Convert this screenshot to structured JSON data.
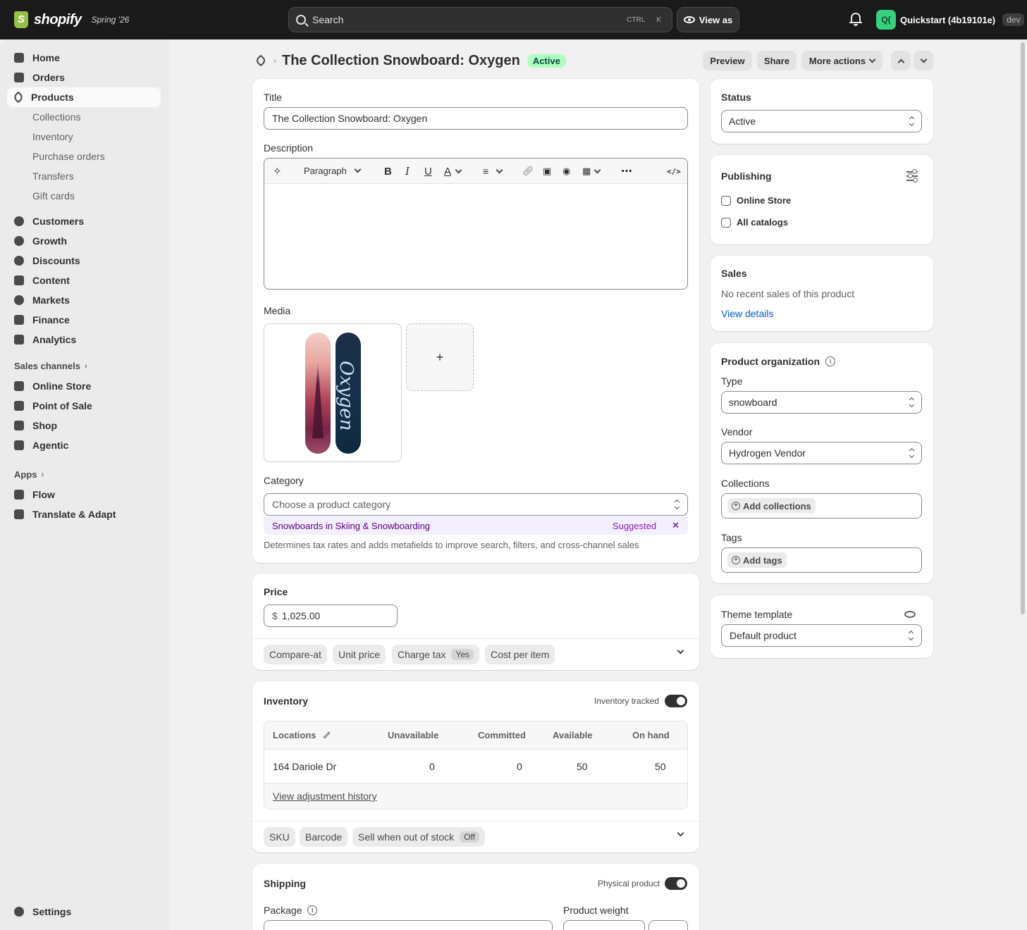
{
  "topbar": {
    "brand": "shopify",
    "edition": "Spring '26",
    "search_placeholder": "Search",
    "shortcut_ctrl": "CTRL",
    "shortcut_key": "K",
    "view_as": "View as",
    "store_initials": "Q(",
    "store_name": "Quickstart (4b19101e)",
    "store_badge": "dev"
  },
  "sidebar": {
    "items": [
      {
        "label": "Home"
      },
      {
        "label": "Orders"
      },
      {
        "label": "Products"
      },
      {
        "label": "Customers"
      },
      {
        "label": "Growth"
      },
      {
        "label": "Discounts"
      },
      {
        "label": "Content"
      },
      {
        "label": "Markets"
      },
      {
        "label": "Finance"
      },
      {
        "label": "Analytics"
      }
    ],
    "product_subitems": [
      "Collections",
      "Inventory",
      "Purchase orders",
      "Transfers",
      "Gift cards"
    ],
    "sales_channels_label": "Sales channels",
    "sales_channels": [
      "Online Store",
      "Point of Sale",
      "Shop",
      "Agentic"
    ],
    "apps_label": "Apps",
    "apps": [
      "Flow",
      "Translate & Adapt"
    ],
    "settings": "Settings"
  },
  "header": {
    "title": "The Collection Snowboard: Oxygen",
    "status_badge": "Active",
    "preview": "Preview",
    "share": "Share",
    "more_actions": "More actions"
  },
  "product": {
    "title_label": "Title",
    "title_value": "The Collection Snowboard: Oxygen",
    "description_label": "Description",
    "paragraph_select": "Paragraph",
    "media_label": "Media",
    "media_add": "+",
    "board_text": "Oxygen",
    "category_label": "Category",
    "category_placeholder": "Choose a product category",
    "suggestion": "Snowboards in Skiing & Snowboarding",
    "suggested": "Suggested",
    "dismiss": "✕",
    "category_help": "Determines tax rates and adds metafields to improve search, filters, and cross-channel sales"
  },
  "price": {
    "label": "Price",
    "currency": "$",
    "value": "1,025.00",
    "chips": {
      "compare_at": "Compare-at",
      "unit_price": "Unit price",
      "charge_tax": "Charge tax",
      "charge_tax_value": "Yes",
      "cost_per_item": "Cost per item"
    }
  },
  "inventory": {
    "label": "Inventory",
    "tracked_label": "Inventory tracked",
    "tracked": true,
    "columns": [
      "Locations",
      "Unavailable",
      "Committed",
      "Available",
      "On hand"
    ],
    "rows": [
      {
        "location": "164 Dariole Dr",
        "unavailable": "0",
        "committed": "0",
        "available": "50",
        "on_hand": "50"
      }
    ],
    "history_link": "View adjustment history",
    "chips": {
      "sku": "SKU",
      "barcode": "Barcode",
      "sell_oos": "Sell when out of stock",
      "sell_oos_value": "Off"
    }
  },
  "shipping": {
    "label": "Shipping",
    "physical_label": "Physical product",
    "physical": true,
    "package_label": "Package",
    "weight_label": "Product weight"
  },
  "status_card": {
    "label": "Status",
    "value": "Active"
  },
  "publishing": {
    "label": "Publishing",
    "channels": [
      "Online Store",
      "All catalogs"
    ]
  },
  "sales": {
    "label": "Sales",
    "text": "No recent sales of this product",
    "link": "View details"
  },
  "organization": {
    "label": "Product organization",
    "type_label": "Type",
    "type_value": "snowboard",
    "vendor_label": "Vendor",
    "vendor_value": "Hydrogen Vendor",
    "collections_label": "Collections",
    "collections_add": "Add collections",
    "tags_label": "Tags",
    "tags_add": "Add tags"
  },
  "theme": {
    "label": "Theme template",
    "value": "Default product"
  },
  "colors": {
    "topbar": "#1a1a1a",
    "active_badge_bg": "#affebf",
    "link": "#005bd3",
    "suggest_bg": "#f3efff",
    "store_avatar": "#36d07e"
  }
}
